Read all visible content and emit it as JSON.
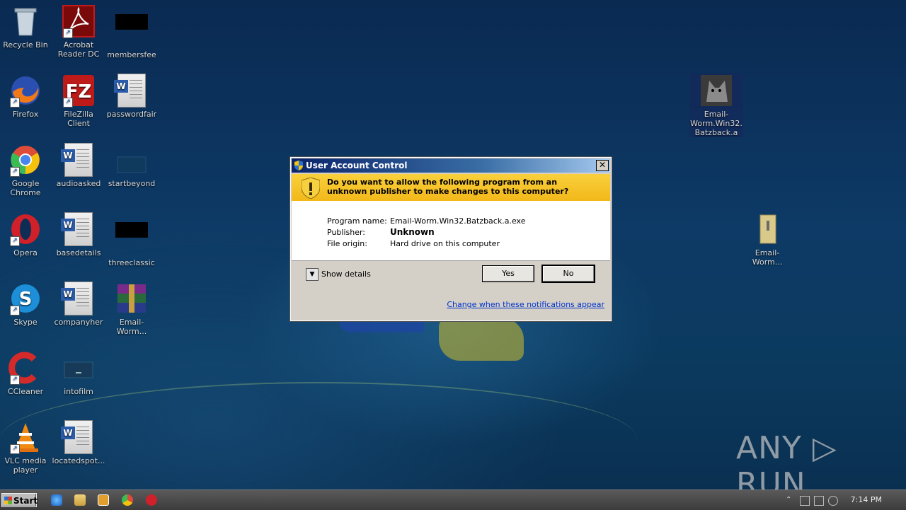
{
  "desktop_icons": [
    {
      "label": "Recycle Bin"
    },
    {
      "label": "Acrobat Reader DC"
    },
    {
      "label": "membersfee"
    },
    {
      "label": "Firefox"
    },
    {
      "label": "FileZilla Client"
    },
    {
      "label": "passwordfair"
    },
    {
      "label": "Google Chrome"
    },
    {
      "label": "audioasked"
    },
    {
      "label": "startbeyond"
    },
    {
      "label": "Opera"
    },
    {
      "label": "basedetails"
    },
    {
      "label": "threeclassic"
    },
    {
      "label": "Skype"
    },
    {
      "label": "companyher"
    },
    {
      "label": "Email-Worm..."
    },
    {
      "label": "CCleaner"
    },
    {
      "label": "intofilm"
    },
    {
      "label": "VLC media player"
    },
    {
      "label": "locatedspot..."
    },
    {
      "label": "Email-Worm.Win32.Batzback.a"
    },
    {
      "label": "Email-Worm..."
    }
  ],
  "uac": {
    "title": "User Account Control",
    "close_glyph": "✕",
    "question": "Do you want to allow the following program from an unknown publisher to make changes to this computer?",
    "rows": [
      {
        "key": "Program name:",
        "value": "Email-Worm.Win32.Batzback.a.exe"
      },
      {
        "key": "Publisher:",
        "value": "Unknown"
      },
      {
        "key": "File origin:",
        "value": "Hard drive on this computer"
      }
    ],
    "details_label": "Show details",
    "yes_label": "Yes",
    "no_label": "No",
    "link_label": "Change when these notifications appear"
  },
  "taskbar": {
    "start_label": "Start",
    "clock": "7:14 PM"
  },
  "watermark": "ANY ▷ RUN",
  "colors": {
    "banner": "#f2b81a",
    "title_bar": "#0a246a",
    "link": "#0033cc"
  }
}
